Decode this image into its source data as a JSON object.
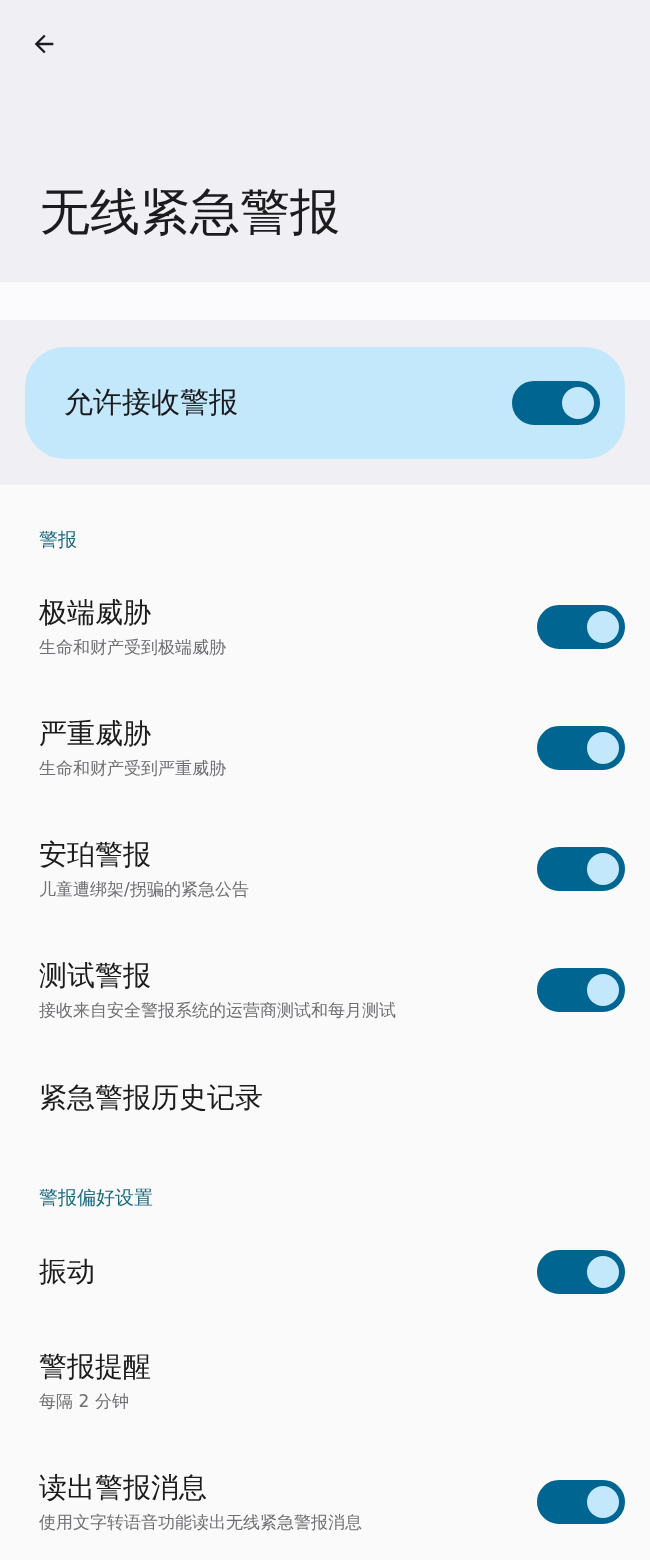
{
  "app_bar": {
    "title": "无线紧急警报"
  },
  "main_switch": {
    "label": "允许接收警报",
    "on": true
  },
  "sections": [
    {
      "heading": "警报",
      "items": [
        {
          "kind": "switch",
          "title": "极端威胁",
          "subtitle": "生命和财产受到极端威胁",
          "on": true
        },
        {
          "kind": "switch",
          "title": "严重威胁",
          "subtitle": "生命和财产受到严重威胁",
          "on": true
        },
        {
          "kind": "switch",
          "title": "安珀警报",
          "subtitle": "儿童遭绑架/拐骗的紧急公告",
          "on": true
        },
        {
          "kind": "switch",
          "title": "测试警报",
          "subtitle": "接收来自安全警报系统的运营商测试和每月测试",
          "on": true
        },
        {
          "kind": "link",
          "title": "紧急警报历史记录"
        }
      ]
    },
    {
      "heading": "警报偏好设置",
      "items": [
        {
          "kind": "switch",
          "title": "振动",
          "on": true
        },
        {
          "kind": "link",
          "title": "警报提醒",
          "subtitle": "每隔 2 分钟"
        },
        {
          "kind": "switch",
          "title": "读出警报消息",
          "subtitle": "使用文字转语音功能读出无线紧急警报消息",
          "on": true
        }
      ]
    }
  ]
}
